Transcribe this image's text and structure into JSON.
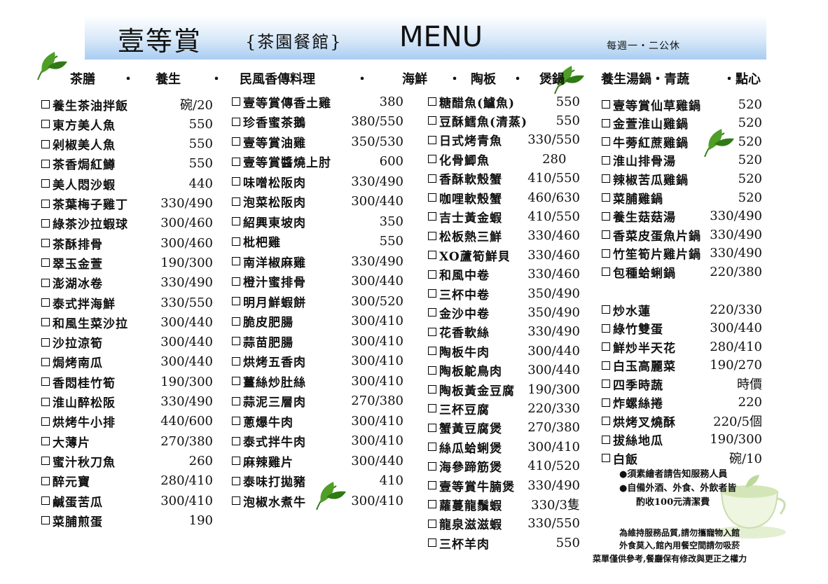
{
  "header": {
    "brand": "壹等賞",
    "subtitle": "{茶園餐館}",
    "menu": "MENU",
    "closed_note": "每週一・二公休"
  },
  "categories": [
    {
      "label": "茶膳"
    },
    {
      "label": "・"
    },
    {
      "label": "養生"
    },
    {
      "label": "・"
    },
    {
      "label": "民風香傳料理"
    },
    {
      "label": "・"
    },
    {
      "label": "海鮮"
    },
    {
      "label": "・"
    },
    {
      "label": "陶板"
    },
    {
      "label": "・"
    },
    {
      "label": "煲鍋"
    },
    {
      "label": "養生湯鍋・青蔬"
    },
    {
      "label": "・點心"
    }
  ],
  "columns": [
    {
      "items": [
        {
          "name": "養生茶油拌飯",
          "price": "碗/20"
        },
        {
          "name": "東方美人魚",
          "price": "550"
        },
        {
          "name": "剁椒美人魚",
          "price": "550"
        },
        {
          "name": "茶香焗紅鱒",
          "price": "550"
        },
        {
          "name": "美人悶沙蝦",
          "price": "440"
        },
        {
          "name": "茶葉梅子雞丁",
          "price": "330/490"
        },
        {
          "name": "綠茶沙拉蝦球",
          "price": "300/460"
        },
        {
          "name": "茶酥排骨",
          "price": "300/460"
        },
        {
          "name": "翠玉金萱",
          "price": "190/300"
        },
        {
          "name": "澎湖冰卷",
          "price": "330/490"
        },
        {
          "name": "泰式拌海鮮",
          "price": "330/550"
        },
        {
          "name": "和風生菜沙拉",
          "price": "300/440"
        },
        {
          "name": "沙拉涼筍",
          "price": "300/440"
        },
        {
          "name": "焗烤南瓜",
          "price": "300/440"
        },
        {
          "name": "香悶桂竹筍",
          "price": "190/300"
        },
        {
          "name": "淮山醉松阪",
          "price": "330/490"
        },
        {
          "name": "烘烤牛小排",
          "price": "440/600"
        },
        {
          "name": "大薄片",
          "price": "270/380"
        },
        {
          "name": "蜜汁秋刀魚",
          "price": "260"
        },
        {
          "name": "醉元寶",
          "price": "280/410"
        },
        {
          "name": "鹹蛋苦瓜",
          "price": "300/410"
        },
        {
          "name": "菜脯煎蛋",
          "price": "190"
        }
      ]
    },
    {
      "items": [
        {
          "name": "壹等賞傳香土雞",
          "price": "380"
        },
        {
          "name": "珍香蜜茶鵝",
          "price": "380/550"
        },
        {
          "name": "壹等賞油雞",
          "price": "350/530"
        },
        {
          "name": "壹等賞醬燒上肘",
          "price": "600"
        },
        {
          "name": "味噌松阪肉",
          "price": "330/490"
        },
        {
          "name": "泡菜松阪肉",
          "price": "300/440"
        },
        {
          "name": "紹興東坡肉",
          "price": "350"
        },
        {
          "name": "枇杷雞",
          "price": "550"
        },
        {
          "name": "南洋椒麻雞",
          "price": "330/490"
        },
        {
          "name": "橙汁蜜排骨",
          "price": "300/440"
        },
        {
          "name": "明月鮮蝦餅",
          "price": "300/520"
        },
        {
          "name": "脆皮肥腸",
          "price": "300/410"
        },
        {
          "name": "蒜苗肥腸",
          "price": "300/410"
        },
        {
          "name": "烘烤五香肉",
          "price": "300/410"
        },
        {
          "name": "薑絲炒肚絲",
          "price": "300/410"
        },
        {
          "name": "蒜泥三層肉",
          "price": "270/380"
        },
        {
          "name": "蔥爆牛肉",
          "price": "300/410"
        },
        {
          "name": "泰式拌牛肉",
          "price": "300/410"
        },
        {
          "name": "麻辣雞片",
          "price": "300/440"
        },
        {
          "name": "泰味打拋豬",
          "price": "410"
        },
        {
          "name": "泡椒水煮牛",
          "price": "300/410"
        }
      ]
    },
    {
      "items": [
        {
          "name": "糖醋魚(鱸魚)",
          "price": "550"
        },
        {
          "name": "豆酥鱈魚(清蒸)",
          "price": "550"
        },
        {
          "name": "日式烤青魚",
          "price": "330/550"
        },
        {
          "name": "化骨鯽魚",
          "price": "280"
        },
        {
          "name": "香酥軟殼蟹",
          "price": "410/550"
        },
        {
          "name": "咖哩軟殼蟹",
          "price": "460/630"
        },
        {
          "name": "吉士黃金蝦",
          "price": "410/550"
        },
        {
          "name": "松板熱三鮮",
          "price": "330/460"
        },
        {
          "name": "XO蘆筍鮮貝",
          "price": "330/460"
        },
        {
          "name": "和風中卷",
          "price": "330/460"
        },
        {
          "name": "三杯中卷",
          "price": "350/490"
        },
        {
          "name": "金沙中卷",
          "price": "350/490"
        },
        {
          "name": "花香軟絲",
          "price": "330/490"
        },
        {
          "name": "陶板牛肉",
          "price": "300/440"
        },
        {
          "name": "陶板鴕鳥肉",
          "price": "300/440"
        },
        {
          "name": "陶板黃金豆腐",
          "price": "190/300"
        },
        {
          "name": "三杯豆腐",
          "price": "220/330"
        },
        {
          "name": "蟹黃豆腐煲",
          "price": "270/380"
        },
        {
          "name": "絲瓜蛤蜊煲",
          "price": "300/410"
        },
        {
          "name": "海參蹄筋煲",
          "price": "410/520"
        },
        {
          "name": "壹等賞牛腩煲",
          "price": "330/490"
        },
        {
          "name": "蘿蔓龍鬚蝦",
          "price": "330/3隻"
        },
        {
          "name": "龍泉滋滋蝦",
          "price": "330/550"
        },
        {
          "name": "三杯羊肉",
          "price": "550"
        }
      ]
    },
    {
      "items": [
        {
          "name": "壹等賞仙草雞鍋",
          "price": "520"
        },
        {
          "name": "金萱淮山雞鍋",
          "price": "520"
        },
        {
          "name": "牛蒡紅蔗雞鍋",
          "price": "520"
        },
        {
          "name": "淮山排骨湯",
          "price": "520"
        },
        {
          "name": "辣椒苦瓜雞鍋",
          "price": "520"
        },
        {
          "name": "菜脯雞鍋",
          "price": "520"
        },
        {
          "name": "養生菇菇湯",
          "price": "330/490"
        },
        {
          "name": "香菜皮蛋魚片鍋",
          "price": "330/490"
        },
        {
          "name": "竹笙筍片雞片鍋",
          "price": "330/490"
        },
        {
          "name": "包種蛤蜊鍋",
          "price": "220/380"
        }
      ]
    },
    {
      "items": [
        {
          "name": "炒水蓮",
          "price": "220/330"
        },
        {
          "name": "綠竹雙蛋",
          "price": "300/440"
        },
        {
          "name": "鮮炒半天花",
          "price": "280/410"
        },
        {
          "name": "白玉高麗菜",
          "price": "190/270"
        },
        {
          "name": "四季時蔬",
          "price": "時價"
        },
        {
          "name": "炸螺絲捲",
          "price": "220"
        },
        {
          "name": "烘烤叉燒酥",
          "price": "220/5個"
        },
        {
          "name": "拔絲地瓜",
          "price": "190/300"
        },
        {
          "name": "白飯",
          "price": "碗/10"
        }
      ]
    }
  ],
  "notes": {
    "n1": "●須素繪者請告知服務人員",
    "n2": "●自備外酒、外食、外飲者皆",
    "n3": "酌收100元清潔費"
  },
  "footer": {
    "f1": "為維持服務品質,請勿攜寵物入館",
    "f2": "外食莫入,館內用餐空間請勿吸菸",
    "f3": "菜單僅供參考,餐廳保有修改與更正之權力"
  }
}
